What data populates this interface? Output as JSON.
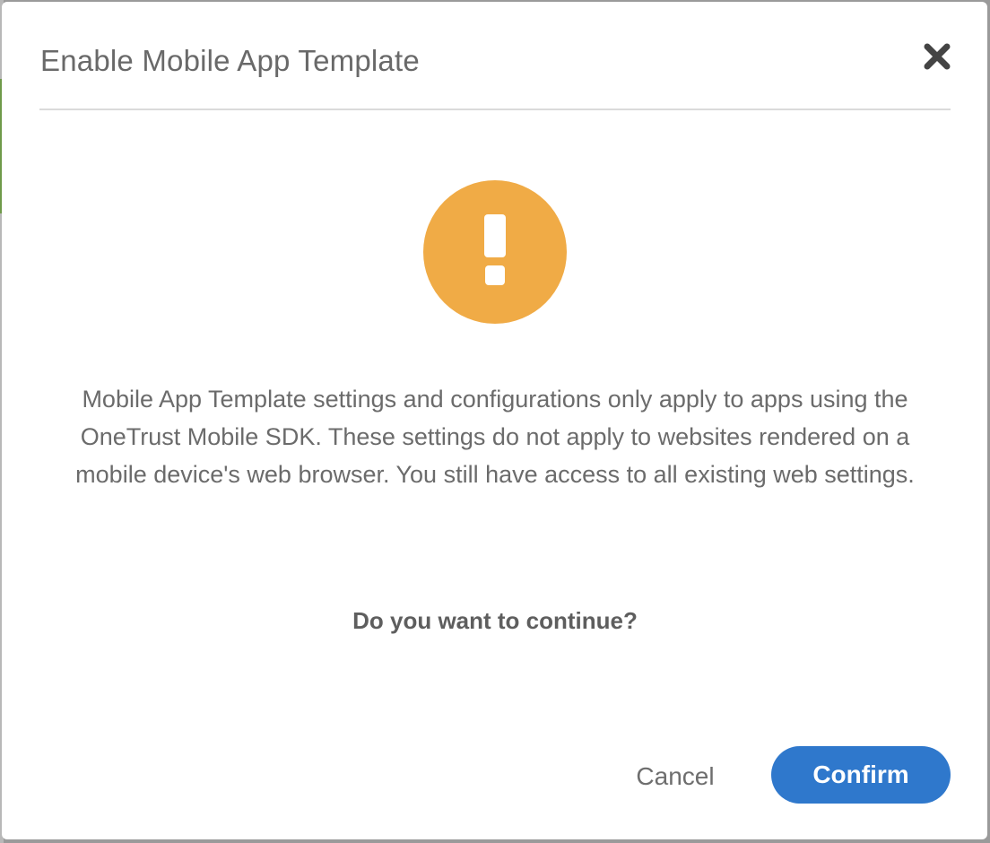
{
  "dialog": {
    "title": "Enable Mobile App Template",
    "close_icon": "close-icon",
    "status_icon": "exclamation-warning-icon",
    "accent_color": "#f0ab46",
    "message": "Mobile App Template settings and configurations only apply to apps using the OneTrust Mobile SDK. These settings do not apply to websites rendered on a mobile device's web browser. You still have access to all existing web settings.",
    "question": "Do you want to continue?",
    "cancel_label": "Cancel",
    "confirm_label": "Confirm",
    "confirm_color": "#2f78cc"
  }
}
